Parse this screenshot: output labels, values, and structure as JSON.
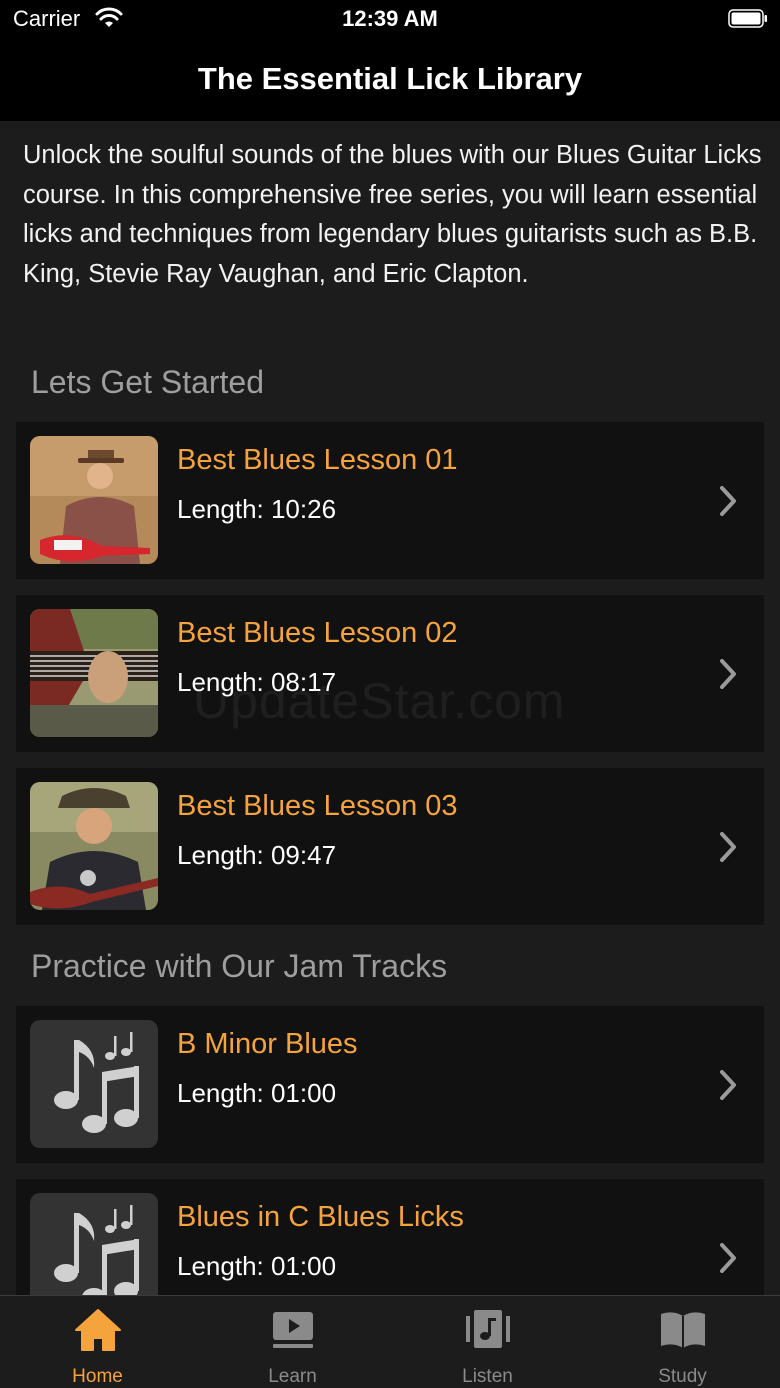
{
  "status_bar": {
    "carrier": "Carrier",
    "time": "12:39 AM"
  },
  "nav": {
    "title": "The Essential Lick Library"
  },
  "intro": "Unlock the soulful sounds of the blues with our Blues Guitar Licks course. In this comprehensive free series, you will learn essential licks and techniques from legendary blues guitarists such as B.B. King, Stevie Ray Vaughan, and Eric Clapton.",
  "sections": [
    {
      "header": "Lets Get Started",
      "items": [
        {
          "title": "Best Blues Lesson 01",
          "length": "Length: 10:26"
        },
        {
          "title": "Best Blues Lesson 02",
          "length": "Length: 08:17"
        },
        {
          "title": "Best Blues Lesson 03",
          "length": "Length: 09:47"
        }
      ]
    },
    {
      "header": "Practice with Our Jam Tracks",
      "items": [
        {
          "title": "B Minor Blues",
          "length": "Length: 01:00"
        },
        {
          "title": "Blues in C Blues Licks",
          "length": "Length: 01:00"
        }
      ]
    }
  ],
  "tabs": [
    {
      "label": "Home",
      "icon": "home-icon",
      "active": true
    },
    {
      "label": "Learn",
      "icon": "video-icon",
      "active": false
    },
    {
      "label": "Listen",
      "icon": "music-video-icon",
      "active": false
    },
    {
      "label": "Study",
      "icon": "book-icon",
      "active": false
    }
  ],
  "watermark": "UpdateStar.com",
  "colors": {
    "accent": "#f5a33d",
    "background": "#1c1c1c",
    "card": "#111111",
    "header_text": "#9e9e9e"
  }
}
